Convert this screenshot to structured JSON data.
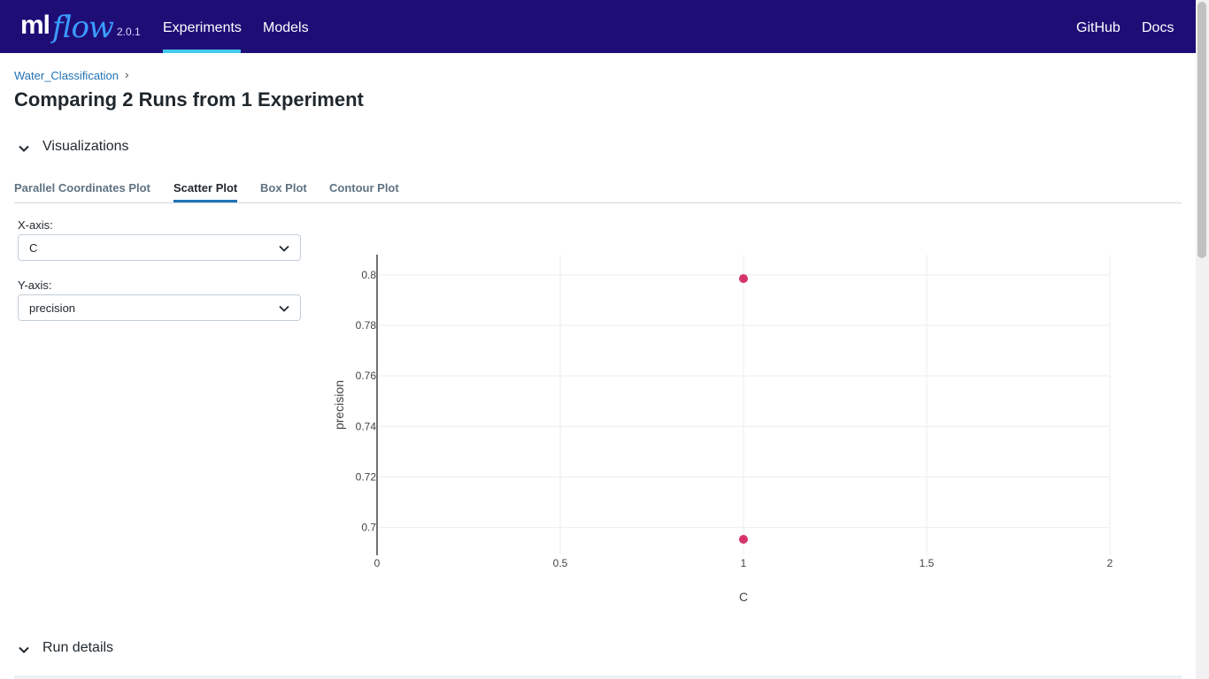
{
  "header": {
    "logo_ml": "ml",
    "logo_flow": "flow",
    "version": "2.0.1",
    "nav": [
      {
        "label": "Experiments",
        "active": true
      },
      {
        "label": "Models",
        "active": false
      }
    ],
    "right_links": [
      {
        "label": "GitHub"
      },
      {
        "label": "Docs"
      }
    ],
    "bg_color": "#1f0d76",
    "accent_color": "#43c9ed"
  },
  "breadcrumb": {
    "experiment": "Water_Classification",
    "separator": "›"
  },
  "page_title": "Comparing 2 Runs from 1 Experiment",
  "sections": {
    "visualizations": {
      "label": "Visualizations",
      "expanded": true,
      "icon": "chevron-down-icon"
    },
    "run_details": {
      "label": "Run details",
      "expanded": true,
      "icon": "chevron-down-icon"
    }
  },
  "tabs": [
    {
      "label": "Parallel Coordinates Plot",
      "active": false
    },
    {
      "label": "Scatter Plot",
      "active": true
    },
    {
      "label": "Box Plot",
      "active": false
    },
    {
      "label": "Contour Plot",
      "active": false
    }
  ],
  "controls": {
    "x_axis": {
      "label": "X-axis:",
      "value": "C"
    },
    "y_axis": {
      "label": "Y-axis:",
      "value": "precision"
    }
  },
  "chart_data": {
    "type": "scatter",
    "title": "",
    "xlabel": "C",
    "ylabel": "precision",
    "xlim": [
      0,
      2
    ],
    "ylim": [
      0.689,
      0.808
    ],
    "x_ticks": [
      0,
      0.5,
      1,
      1.5,
      2
    ],
    "y_ticks": [
      0.7,
      0.72,
      0.74,
      0.76,
      0.78,
      0.8
    ],
    "grid": true,
    "point_color": "#d6336c",
    "series": [
      {
        "x": [
          1,
          1
        ],
        "y": [
          0.7985,
          0.6953
        ]
      }
    ]
  }
}
